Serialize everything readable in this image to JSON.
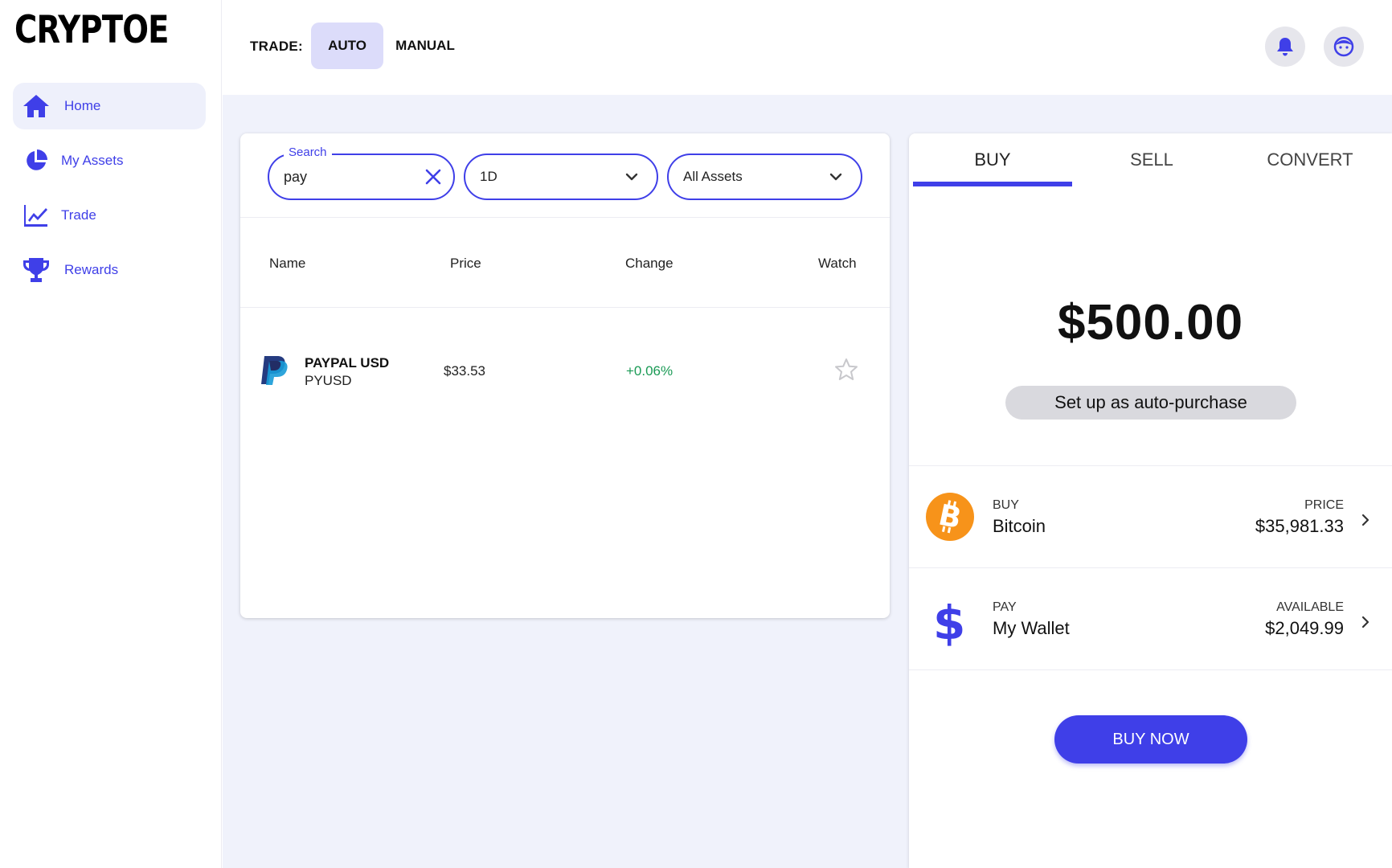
{
  "app": {
    "logo": "CRYPTOE"
  },
  "sidebar": {
    "items": [
      {
        "label": "Home",
        "icon": "home-icon",
        "active": true
      },
      {
        "label": "My Assets",
        "icon": "pie-chart-icon",
        "active": false
      },
      {
        "label": "Trade",
        "icon": "line-chart-icon",
        "active": false
      },
      {
        "label": "Rewards",
        "icon": "trophy-icon",
        "active": false
      }
    ]
  },
  "topbar": {
    "trade_label": "TRADE:",
    "modes": [
      "AUTO",
      "MANUAL"
    ],
    "selected_mode": "AUTO"
  },
  "filters": {
    "search_label": "Search",
    "search_value": "pay",
    "range_value": "1D",
    "assets_value": "All Assets"
  },
  "table": {
    "headers": [
      "Name",
      "Price",
      "Change",
      "Watch"
    ],
    "rows": [
      {
        "name": "PAYPAL USD",
        "symbol": "PYUSD",
        "price": "$33.53",
        "change": "+0.06%",
        "icon": "paypal-icon"
      }
    ]
  },
  "panel": {
    "tabs": [
      "BUY",
      "SELL",
      "CONVERT"
    ],
    "active_tab": "BUY",
    "amount": "$500.00",
    "auto_purchase_label": "Set up as auto-purchase",
    "buy_row": {
      "kicker": "BUY",
      "asset": "Bitcoin",
      "right_kicker": "PRICE",
      "right_value": "$35,981.33"
    },
    "pay_row": {
      "kicker": "PAY",
      "asset": "My Wallet",
      "right_kicker": "AVAILABLE",
      "right_value": "$2,049.99"
    },
    "buy_now_label": "BUY NOW"
  },
  "colors": {
    "accent": "#3f3fe8",
    "positive": "#1a9a55",
    "bitcoin": "#f7931a",
    "background": "#f0f2fb"
  }
}
